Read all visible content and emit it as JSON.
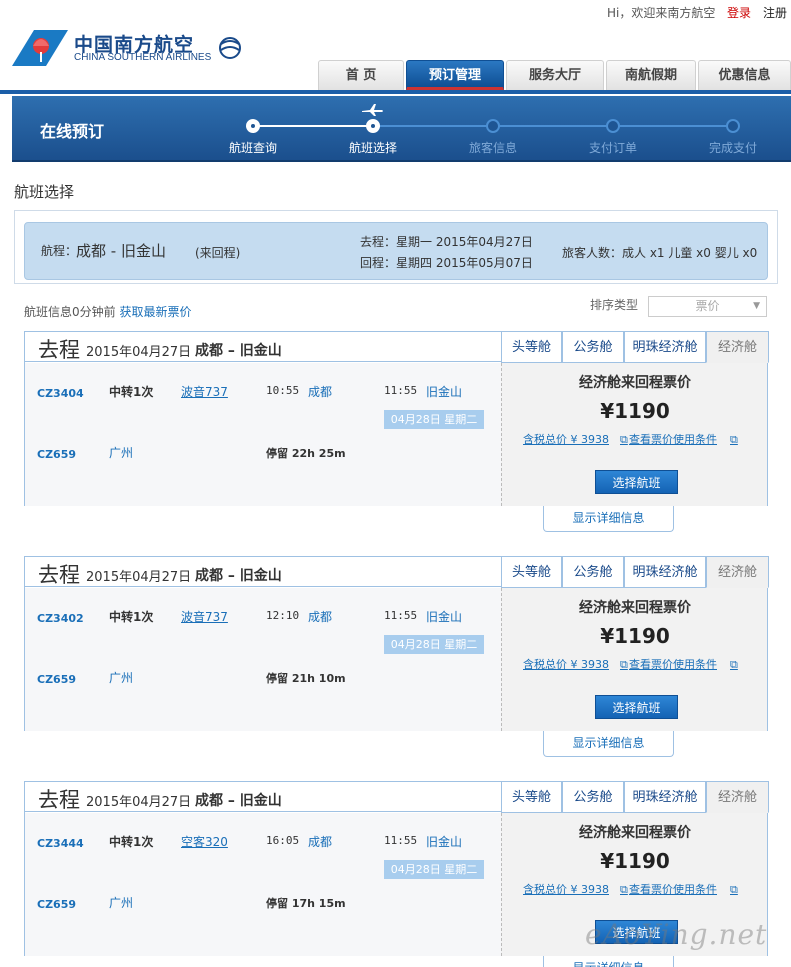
{
  "topbar": {
    "welcome": "Hi，欢迎来南方航空",
    "login": "登录",
    "register": "注册"
  },
  "logo": {
    "cn": "中国南方航空",
    "en": "CHINA SOUTHERN AIRLINES"
  },
  "nav": [
    {
      "label": "首 页",
      "active": false
    },
    {
      "label": "预订管理",
      "active": true
    },
    {
      "label": "服务大厅",
      "active": false
    },
    {
      "label": "南航假期",
      "active": false
    },
    {
      "label": "优惠信息",
      "active": false
    }
  ],
  "banner": {
    "title": "在线预订",
    "steps": [
      "航班查询",
      "航班选择",
      "旅客信息",
      "支付订单",
      "完成支付"
    ],
    "current_step": 2
  },
  "section_title": "航班选择",
  "summary": {
    "route_label": "航程：",
    "route": "成都 - 旧金山",
    "trip_type": "(来回程)",
    "outbound": "去程：星期一 2015年04月27日",
    "return": "回程：星期四 2015年05月07日",
    "passengers": "旅客人数：成人 x1 儿童 x0 婴儿 x0"
  },
  "info": {
    "text": "航班信息0分钟前",
    "refresh": "获取最新票价"
  },
  "sort": {
    "label": "排序类型",
    "value": "票价"
  },
  "cabins": [
    "头等舱",
    "公务舱",
    "明珠经济舱",
    "经济舱"
  ],
  "cards": [
    {
      "dir": "去程",
      "date": "2015年04月27日",
      "cities": "成都 – 旧金山",
      "flight1": "CZ3404",
      "transfer": "中转1次",
      "plane": "波音737",
      "dep_time": "10:55",
      "dep_city": "成都",
      "arr_time": "11:55",
      "arr_city": "旧金山",
      "next_day": "04月28日 星期二",
      "flight2": "CZ659",
      "via": "广州",
      "stop": "停留 22h 25m",
      "price_title": "经济舱来回程票价",
      "price": "¥1190",
      "tax": "含税总价 ¥ 3938",
      "rules": "查看票价使用条件",
      "select": "选择航班",
      "detail": "显示详细信息"
    },
    {
      "dir": "去程",
      "date": "2015年04月27日",
      "cities": "成都 – 旧金山",
      "flight1": "CZ3402",
      "transfer": "中转1次",
      "plane": "波音737",
      "dep_time": "12:10",
      "dep_city": "成都",
      "arr_time": "11:55",
      "arr_city": "旧金山",
      "next_day": "04月28日 星期二",
      "flight2": "CZ659",
      "via": "广州",
      "stop": "停留 21h 10m",
      "price_title": "经济舱来回程票价",
      "price": "¥1190",
      "tax": "含税总价 ¥ 3938",
      "rules": "查看票价使用条件",
      "select": "选择航班",
      "detail": "显示详细信息"
    },
    {
      "dir": "去程",
      "date": "2015年04月27日",
      "cities": "成都 – 旧金山",
      "flight1": "CZ3444",
      "transfer": "中转1次",
      "plane": "空客320",
      "dep_time": "16:05",
      "dep_city": "成都",
      "arr_time": "11:55",
      "arr_city": "旧金山",
      "next_day": "04月28日 星期二",
      "flight2": "CZ659",
      "via": "广州",
      "stop": "停留 17h 15m",
      "price_title": "经济舱来回程票价",
      "price": "¥1190",
      "tax": "含税总价 ¥ 3938",
      "rules": "查看票价使用条件",
      "select": "选择航班",
      "detail": "显示详细信息"
    }
  ],
  "watermark": "eAoYing.net",
  "colors": {
    "brand_blue": "#1b4f8d",
    "link_blue": "#1a6fb8",
    "login_red": "#cc0000",
    "price_box_grey": "#f2f2f2"
  }
}
